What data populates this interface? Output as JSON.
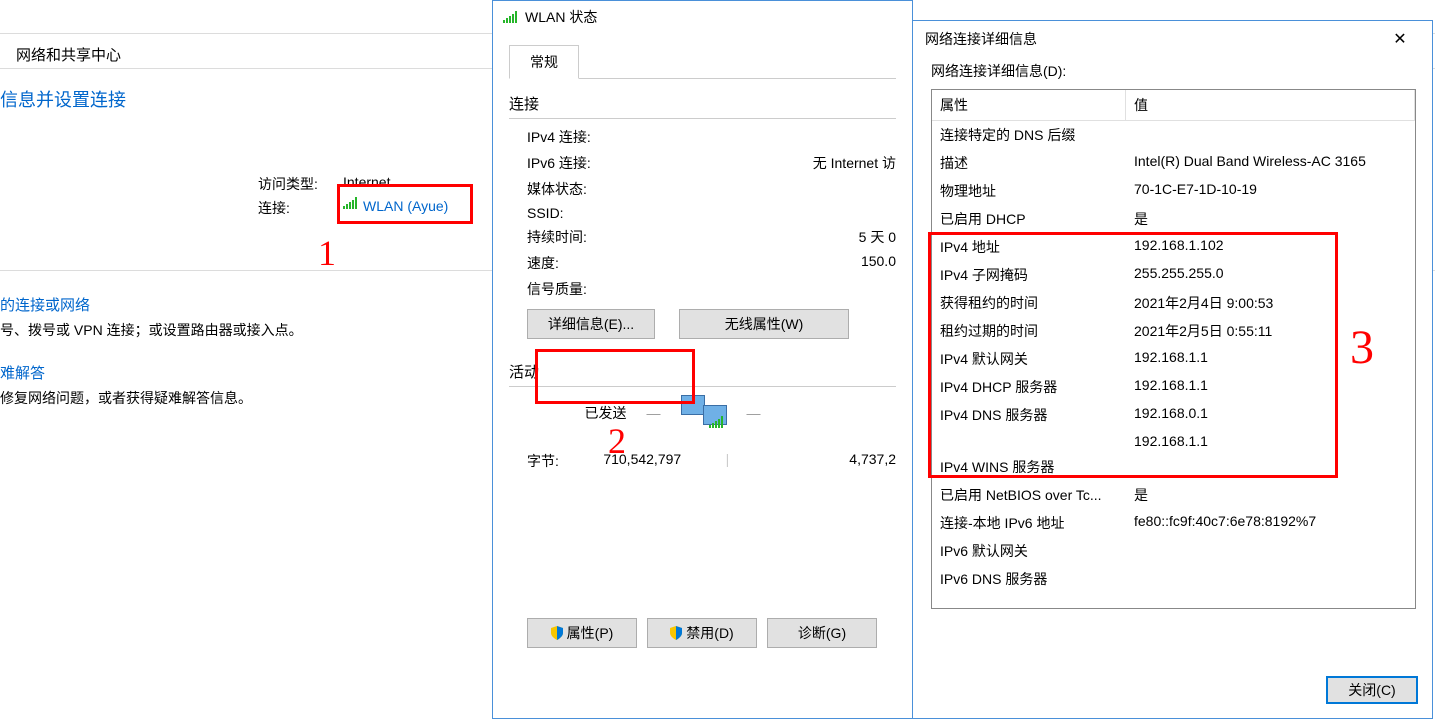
{
  "bg": {
    "ncpTitle": "网络和共享中心",
    "heading": "信息并设置连接",
    "accessTypeLabel": "访问类型:",
    "accessTypeValue": "Internet",
    "connectionsLabel": "连接:",
    "connectionLink": "WLAN (Ayue)",
    "section2Title": "的连接或网络",
    "section2Desc": "号、拨号或 VPN 连接；或设置路由器或接入点。",
    "section3Title": "难解答",
    "section3Desc": "修复网络问题，或者获得疑难解答信息。"
  },
  "wlan": {
    "title": "WLAN 状态",
    "tab": "常规",
    "connectionSection": "连接",
    "ipv4ConnLabel": "IPv4 连接:",
    "ipv6ConnLabel": "IPv6 连接:",
    "ipv6ConnValue": "无 Internet 访",
    "mediaLabel": "媒体状态:",
    "ssidLabel": "SSID:",
    "durationLabel": "持续时间:",
    "durationValue": "5 天 0",
    "speedLabel": "速度:",
    "speedValue": "150.0",
    "signalLabel": "信号质量:",
    "detailsBtn": "详细信息(E)...",
    "wirelessPropsBtn": "无线属性(W)",
    "activitySection": "活动",
    "sentLabel": "已发送",
    "bytesLabel": "字节:",
    "sentBytes": "710,542,797",
    "recvBytes": "4,737,2",
    "propsBtn": "属性(P)",
    "disableBtn": "禁用(D)",
    "diagnoseBtn": "诊断(G)"
  },
  "details": {
    "title": "网络连接详细信息",
    "label": "网络连接详细信息(D):",
    "colProp": "属性",
    "colVal": "值",
    "rows": [
      {
        "p": "连接特定的 DNS 后缀",
        "v": ""
      },
      {
        "p": "描述",
        "v": "Intel(R) Dual Band Wireless-AC 3165"
      },
      {
        "p": "物理地址",
        "v": "70-1C-E7-1D-10-19"
      },
      {
        "p": "已启用 DHCP",
        "v": "是"
      },
      {
        "p": "IPv4 地址",
        "v": "192.168.1.102"
      },
      {
        "p": "IPv4 子网掩码",
        "v": "255.255.255.0"
      },
      {
        "p": "获得租约的时间",
        "v": "2021年2月4日 9:00:53"
      },
      {
        "p": "租约过期的时间",
        "v": "2021年2月5日 0:55:11"
      },
      {
        "p": "IPv4 默认网关",
        "v": "192.168.1.1"
      },
      {
        "p": "IPv4 DHCP 服务器",
        "v": "192.168.1.1"
      },
      {
        "p": "IPv4 DNS 服务器",
        "v": "192.168.0.1"
      },
      {
        "p": "",
        "v": "192.168.1.1"
      },
      {
        "p": "IPv4 WINS 服务器",
        "v": ""
      },
      {
        "p": "已启用 NetBIOS over Tc...",
        "v": "是"
      },
      {
        "p": "连接-本地 IPv6 地址",
        "v": "fe80::fc9f:40c7:6e78:8192%7"
      },
      {
        "p": "IPv6 默认网关",
        "v": ""
      },
      {
        "p": "IPv6 DNS 服务器",
        "v": ""
      }
    ],
    "closeBtn": "关闭(C)"
  },
  "anno": {
    "n1": "1",
    "n2": "2",
    "n3": "3"
  }
}
